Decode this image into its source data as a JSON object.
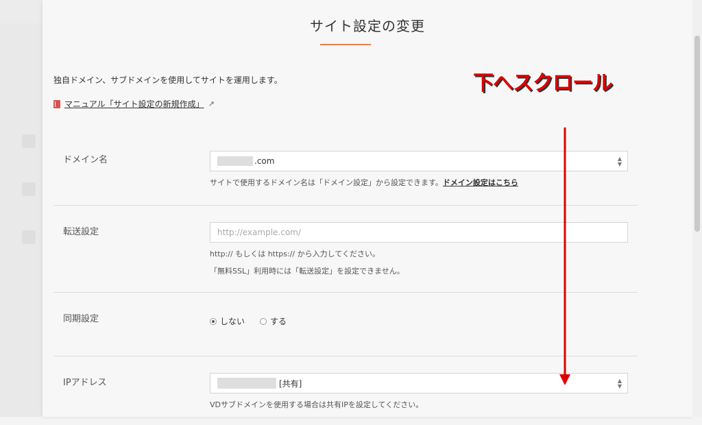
{
  "modal": {
    "title": "サイト設定の変更",
    "description": "独自ドメイン、サブドメインを使用してサイトを運用します。",
    "manual_link": "マニュアル「サイト設定の新規作成」"
  },
  "form": {
    "domain": {
      "label": "ドメイン名",
      "value_suffix": ".com",
      "help_text": "サイトで使用するドメイン名は「ドメイン設定」から設定できます。",
      "help_link": "ドメイン設定はこちら"
    },
    "forward": {
      "label": "転送設定",
      "placeholder": "http://example.com/",
      "help1": "http:// もしくは https:// から入力してください。",
      "help2": "「無料SSL」利用時には「転送設定」を設定できません。"
    },
    "sync": {
      "label": "同期設定",
      "options": [
        {
          "label": "しない",
          "checked": true
        },
        {
          "label": "する",
          "checked": false
        }
      ]
    },
    "ip": {
      "label": "IPアドレス",
      "value_suffix": "[共有]",
      "help_text": "VDサブドメインを使用する場合は共有IPを設定してください。"
    }
  },
  "annotation": {
    "text": "下へスクロール",
    "color": "#e00000"
  },
  "colors": {
    "accent_underline": "#e87d4c",
    "manual_icon": "#d9534f"
  },
  "icons": {
    "manual": "book-icon",
    "external": "external-link-icon",
    "select": "select-arrows-icon"
  }
}
